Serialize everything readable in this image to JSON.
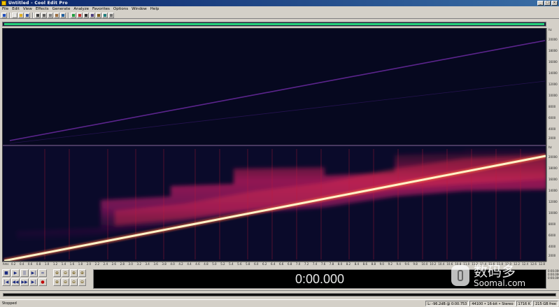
{
  "window": {
    "title": "Untitled - Cool Edit Pro",
    "controls": [
      "_",
      "□",
      "×"
    ]
  },
  "menu": [
    "File",
    "Edit",
    "View",
    "Effects",
    "Generate",
    "Analyze",
    "Favorites",
    "Options",
    "Window",
    "Help"
  ],
  "toolbar": {
    "buttons": [
      "new-file",
      "open-file",
      "save-file",
      "cut",
      "copy",
      "paste",
      "undo",
      "mix-paste",
      "waveform-view",
      "spectral-view",
      "toggle-play",
      "snap",
      "cue",
      "loop",
      "settings"
    ],
    "colors": {
      "accent": "#0a246a",
      "overview": "#26d07a"
    }
  },
  "spectrogram": {
    "background": "#06081f",
    "channels": 2,
    "sweep_color": "#fff4c8",
    "harmonic_color": "#6a2aa0"
  },
  "right_ruler": {
    "top": [
      "hz",
      "20000",
      "18000",
      "16000",
      "14000",
      "12000",
      "10000",
      "8000",
      "6000",
      "4000",
      "2000"
    ],
    "bottom": [
      "hz",
      "20000",
      "18000",
      "16000",
      "14000",
      "12000",
      "10000",
      "8000",
      "6000",
      "4000",
      "2000"
    ]
  },
  "time_ruler": {
    "ticks": [
      "hms",
      "0.2",
      "0.4",
      "0.6",
      "0.8",
      "1.0",
      "1.2",
      "1.4",
      "1.6",
      "1.8",
      "2.0",
      "2.2",
      "2.4",
      "2.6",
      "2.8",
      "3.0",
      "3.2",
      "3.4",
      "3.6",
      "3.8",
      "4.0",
      "4.2",
      "4.4",
      "4.6",
      "4.8",
      "5.0",
      "5.2",
      "5.4",
      "5.6",
      "5.8",
      "6.0",
      "6.2",
      "6.4",
      "6.6",
      "6.8",
      "7.0",
      "7.2",
      "7.4",
      "7.6",
      "7.8",
      "8.0",
      "8.2",
      "8.4",
      "8.6",
      "8.8",
      "9.0",
      "9.2",
      "9.4",
      "9.6",
      "9.8",
      "10.0",
      "10.2",
      "10.4",
      "10.6",
      "10.8",
      "11.0",
      "11.2",
      "11.4",
      "11.6",
      "11.8",
      "12.0",
      "12.2",
      "12.4",
      "12.6",
      "12.8"
    ]
  },
  "transport": {
    "row1": [
      "■",
      "▶",
      "||",
      "▶|",
      "∞"
    ],
    "row2": [
      "|◀",
      "◀◀",
      "▶▶",
      "▶|",
      "●"
    ],
    "zoom_row1": [
      "⊕",
      "⊖",
      "⊕",
      "⊕"
    ],
    "zoom_row2": [
      "⊕",
      "⊖",
      "⊖",
      "⊖"
    ]
  },
  "time_display": "0:00.000",
  "selection_info": [
    "0:00.000",
    "0:00.000",
    "0:00.000"
  ],
  "status": {
    "left": "Stopped",
    "cells": [
      "L: -96.2dB @ 0:00.753",
      "44100 • 16-bit • Stereo",
      "1716 K",
      "215 GB free"
    ]
  },
  "watermark": {
    "cn": "数码多",
    "en": "Soomal.com"
  }
}
